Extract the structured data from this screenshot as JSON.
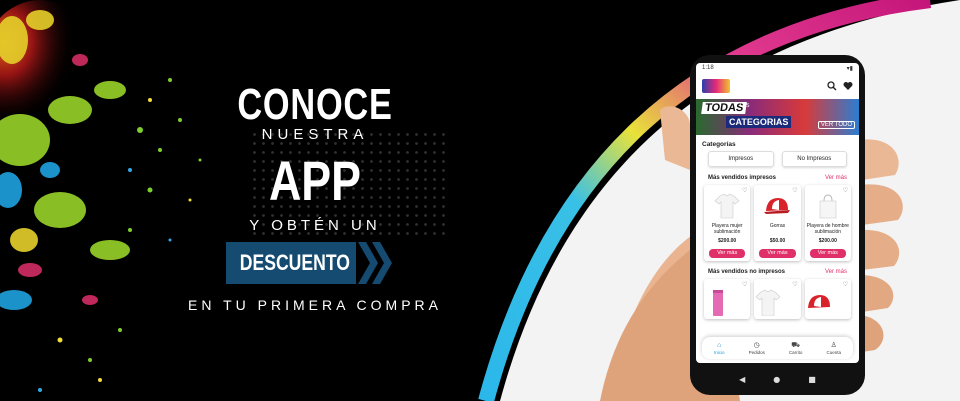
{
  "promo": {
    "line1": "CONOCE",
    "line2": "NUESTRA",
    "line3": "APP",
    "line4": "Y OBTÉN UN",
    "badge": "DESCUENTO",
    "line5": "EN TU PRIMERA COMPRA"
  },
  "colors": {
    "badge_bg": "#154a71",
    "accent_pink": "#e0306a",
    "active_blue": "#1a9ad6"
  },
  "app": {
    "status_time": "1:18",
    "hero": {
      "todas": "TODAS",
      "las": "LAS",
      "categorias": "CATEGORIAS",
      "ver_todo": "VER TODO"
    },
    "categories_title": "Categorías",
    "tabs": [
      "Impresos",
      "No Impresos"
    ],
    "section1": {
      "title": "Más vendidos impresos",
      "link": "Ver más",
      "products": [
        {
          "name": "Playera mujer sublimación",
          "price": "$200.00",
          "button": "Ver más",
          "icon": "white-tshirt"
        },
        {
          "name": "Gorras",
          "price": "$50.00",
          "button": "Ver más",
          "icon": "red-cap"
        },
        {
          "name": "Playera de hombre sublimación",
          "price": "$200.00",
          "button": "Ver más",
          "icon": "tote-bag"
        }
      ]
    },
    "section2": {
      "title": "Más vendidos no impresos",
      "link": "Ver más",
      "products": [
        {
          "icon": "pink-tumbler"
        },
        {
          "icon": "white-tshirt"
        },
        {
          "icon": "red-cap"
        }
      ]
    },
    "nav": [
      {
        "label": "Inicio",
        "icon": "home-icon"
      },
      {
        "label": "Pedidos",
        "icon": "clock-icon"
      },
      {
        "label": "Carrito",
        "icon": "cart-icon"
      },
      {
        "label": "Cuenta",
        "icon": "user-icon"
      }
    ]
  }
}
